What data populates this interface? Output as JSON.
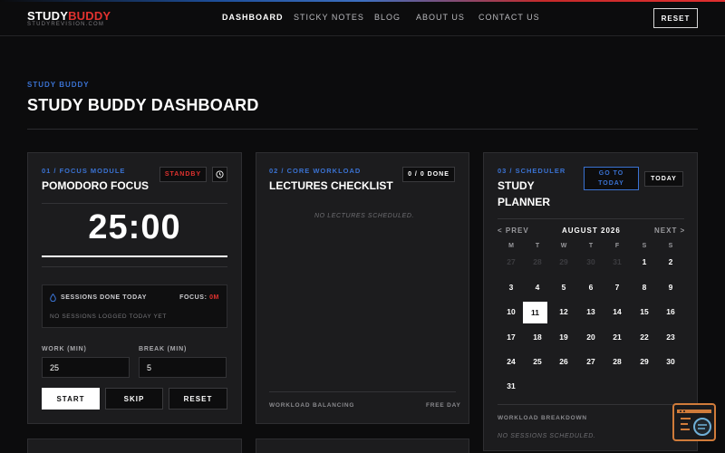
{
  "header": {
    "logo_part1": "STUDY",
    "logo_part2": "BUDDY",
    "logo_sub": "STUDYREVISION.COM",
    "nav": [
      "DASHBOARD",
      "STICKY NOTES",
      "BLOG",
      "ABOUT US",
      "CONTACT US"
    ],
    "active_nav": "DASHBOARD",
    "reset_label": "RESET"
  },
  "page": {
    "kicker": "STUDY BUDDY",
    "title": "STUDY BUDDY DASHBOARD"
  },
  "focus": {
    "label": "01 / FOCUS MODULE",
    "title": "POMODORO FOCUS",
    "status": "STANDBY",
    "timer": "25:00",
    "sessions_title": "SESSIONS DONE TODAY",
    "focus_label": "FOCUS:",
    "focus_value": "0M",
    "sessions_empty": "NO SESSIONS LOGGED TODAY YET",
    "work_label": "WORK (MIN)",
    "work_value": "25",
    "break_label": "BREAK (MIN)",
    "break_value": "5",
    "start_label": "START",
    "skip_label": "SKIP",
    "reset_label": "RESET"
  },
  "lectures": {
    "label": "02 / CORE WORKLOAD",
    "title": "LECTURES CHECKLIST",
    "done_badge": "0 / 0 DONE",
    "empty": "NO LECTURES SCHEDULED.",
    "footer_left": "WORKLOAD BALANCING",
    "footer_right": "FREE DAY"
  },
  "scheduler": {
    "label": "03 / SCHEDULER",
    "title_line1": "STUDY",
    "title_line2": "PLANNER",
    "go_today_line1": "GO TO",
    "go_today_line2": "TODAY",
    "today_label": "TODAY",
    "prev_label": "< PREV",
    "next_label": "NEXT >",
    "month": "AUGUST 2026",
    "weekdays": [
      "M",
      "T",
      "W",
      "T",
      "F",
      "S",
      "S"
    ],
    "muted_days": [
      "27",
      "28",
      "29",
      "30",
      "31"
    ],
    "days": [
      "1",
      "2",
      "3",
      "4",
      "5",
      "6",
      "7",
      "8",
      "9",
      "10",
      "11",
      "12",
      "13",
      "14",
      "15",
      "16",
      "17",
      "18",
      "19",
      "20",
      "21",
      "22",
      "23",
      "24",
      "25",
      "26",
      "27",
      "28",
      "29",
      "30",
      "31"
    ],
    "selected_day": "11",
    "breakdown_label": "WORKLOAD BREAKDOWN",
    "breakdown_empty": "NO SESSIONS SCHEDULED."
  },
  "colors": {
    "accent_blue": "#3a72d2",
    "accent_red": "#e0322f",
    "background": "#0c0c0d",
    "card": "#1c1c1e"
  },
  "icons": {
    "timer": "clock-icon",
    "sessions": "drop-icon",
    "assistant": "chat-bot-icon"
  }
}
